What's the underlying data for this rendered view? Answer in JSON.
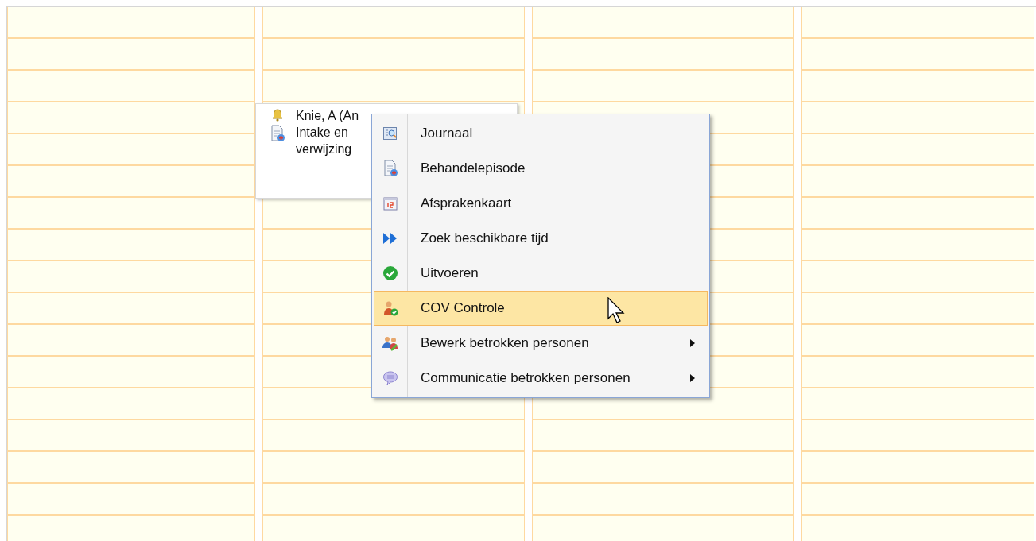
{
  "appointment": {
    "lines": [
      "Knie, A (An",
      "Intake en",
      "verwijzing"
    ]
  },
  "context_menu": {
    "items": [
      {
        "label": "Journaal",
        "selected": false,
        "kind": "action"
      },
      {
        "label": "Behandelepisode",
        "selected": false,
        "kind": "action"
      },
      {
        "label": "Afsprakenkaart",
        "selected": false,
        "kind": "action"
      },
      {
        "label": "Zoek beschikbare tijd",
        "selected": false,
        "kind": "action"
      },
      {
        "label": "Uitvoeren",
        "selected": false,
        "kind": "action"
      },
      {
        "label": "COV Controle",
        "selected": true,
        "kind": "action"
      },
      {
        "label": "Bewerk betrokken personen",
        "selected": false,
        "kind": "submenu"
      },
      {
        "label": "Communicatie betrokken personen",
        "selected": false,
        "kind": "submenu"
      }
    ]
  }
}
